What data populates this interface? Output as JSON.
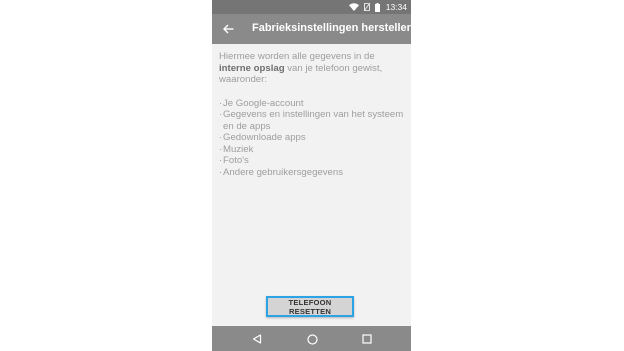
{
  "status_bar": {
    "time": "13:34",
    "icons": [
      "wifi-icon",
      "no-sim-icon",
      "battery-icon"
    ]
  },
  "app_bar": {
    "title": "Fabrieksinstellingen herstellen",
    "back_icon": "arrow-back-icon"
  },
  "content": {
    "intro_before": "Hiermee worden alle gegevens in de ",
    "intro_bold": "interne opslag",
    "intro_after": " van je telefoon gewist, waaronder:",
    "items": [
      "Je Google-account",
      "Gegevens en instellingen van het systeem en de apps",
      "Gedownloade apps",
      "Muziek",
      "Foto's",
      "Andere gebruikersgegevens"
    ]
  },
  "reset_button": {
    "label": "TELEFOON RESETTEN"
  },
  "nav_bar": {
    "icons": [
      "back-triangle-icon",
      "home-circle-icon",
      "recents-square-icon"
    ]
  },
  "colors": {
    "status_bar": "#757575",
    "app_bar": "#8a8a8a",
    "background": "#f2f2f2",
    "body_text": "#9e9e9e",
    "highlight_border": "#2ea3e3"
  }
}
